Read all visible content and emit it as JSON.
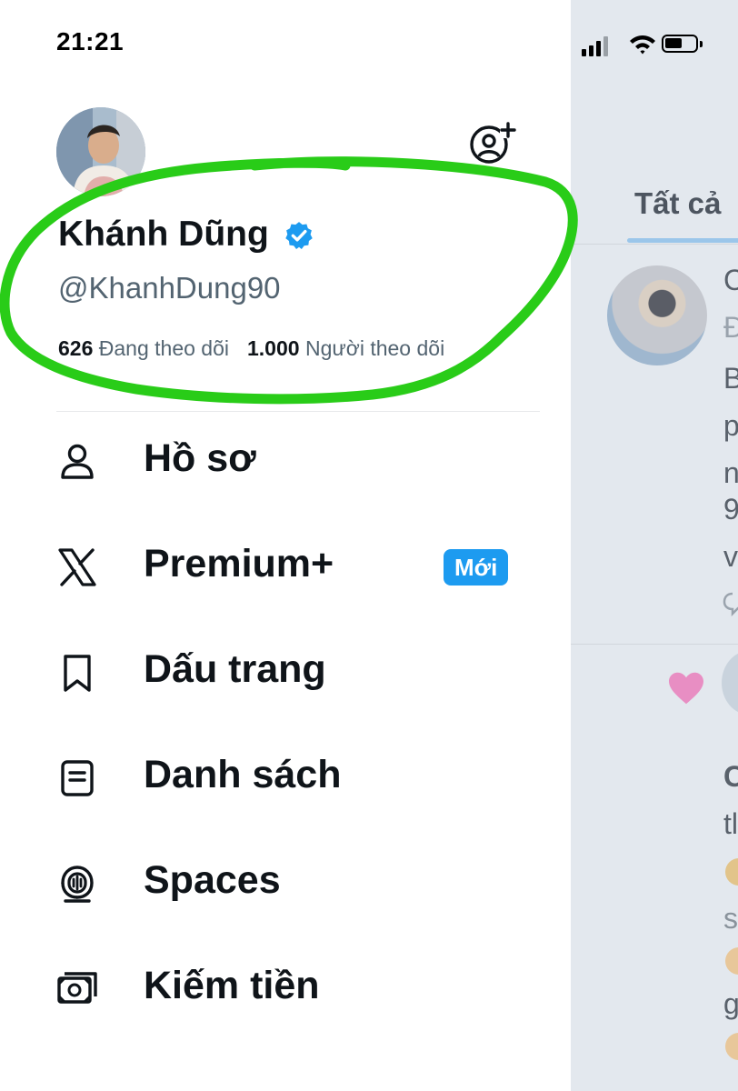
{
  "status_bar": {
    "time": "21:21"
  },
  "profile": {
    "display_name": "Khánh Dũng",
    "handle": "@KhanhDung90",
    "following_count": "626",
    "following_label": "Đang theo dõi",
    "followers_count": "1.000",
    "followers_label": "Người theo dõi"
  },
  "menu": {
    "items": [
      {
        "label": "Hồ sơ",
        "icon": "person-icon"
      },
      {
        "label": "Premium+",
        "icon": "x-logo-icon",
        "badge": "Mới"
      },
      {
        "label": "Dấu trang",
        "icon": "bookmark-icon"
      },
      {
        "label": "Danh sách",
        "icon": "list-icon"
      },
      {
        "label": "Spaces",
        "icon": "spaces-icon"
      },
      {
        "label": "Kiếm tiền",
        "icon": "money-icon"
      }
    ]
  },
  "timeline": {
    "tab_label": "Tất cả",
    "post_lines": [
      "C",
      "Đ",
      "B",
      "p",
      "n",
      "9",
      "v",
      "C",
      "tl",
      "s",
      "g"
    ]
  },
  "colors": {
    "accent": "#1d9bf0",
    "highlight_ring": "#29cc18",
    "text_primary": "#0f1419",
    "text_secondary": "#536471",
    "overlay_bg": "#e3e8ee"
  }
}
